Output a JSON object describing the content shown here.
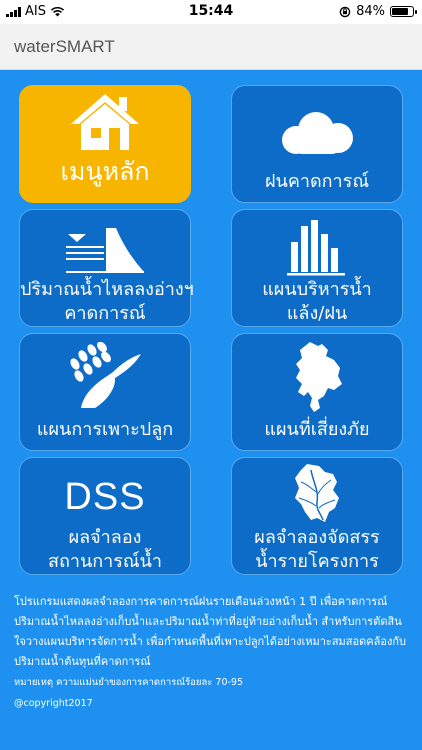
{
  "status_bar": {
    "carrier": "AIS",
    "time": "15:44",
    "battery_percent_text": "84%",
    "battery_level": 0.84
  },
  "app": {
    "title": "waterSMART"
  },
  "tiles": [
    {
      "label": "เมนูหลัก",
      "icon": "home-icon",
      "active": true
    },
    {
      "label": "ฝนคาดการณ์",
      "icon": "cloud-icon",
      "active": false
    },
    {
      "label_line1": "ปริมาณน้ำไหลลงอ่างฯ",
      "label_line2": "คาดการณ์",
      "icon": "dam-icon",
      "active": false
    },
    {
      "label_line1": "แผนบริหารน้ำ",
      "label_line2": "แล้ง/ฝน",
      "icon": "bar-chart-icon",
      "active": false
    },
    {
      "label": "แผนการเพาะปลูก",
      "icon": "rice-icon",
      "active": false
    },
    {
      "label": "แผนที่เสี่ยงภัย",
      "icon": "map-icon",
      "active": false
    },
    {
      "icon_text": "DSS",
      "label_line1": "ผลจำลอง",
      "label_line2": "สถานการณ์น้ำ",
      "active": false
    },
    {
      "label_line1": "ผลจำลองจัดสรร",
      "label_line2": "น้ำรายโครงการ",
      "icon": "river-map-icon",
      "active": false
    }
  ],
  "footer": {
    "description": "โปรแกรมแสดงผลจำลองการคาดการณ์ฝนรายเดือนล่วงหน้า 1 ปี เพื่อคาดการณ์ปริมาณน้ำไหลลงอ่างเก็บน้ำและปริมาณน้ำท่าที่อยู่ท้ายอ่างเก็บน้ำ สำหรับการตัดสินใจวางแผนบริหารจัดการน้ำ เพื่อกำหนดพื้นที่เพาะปลูกได้อย่างเหมาะสมสอดคล้องกับปริมาณน้ำต้นทุนที่คาดการณ์",
    "note": "หมายเหตุ ความแม่นยำของการคาดการณ์ร้อยละ 70-95",
    "copyright": "@copyright2017"
  }
}
